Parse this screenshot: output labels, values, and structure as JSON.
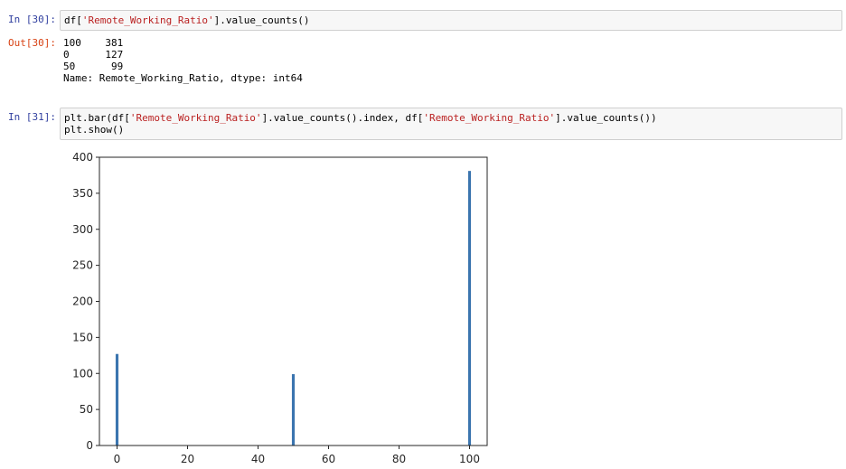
{
  "cells": [
    {
      "in_prompt": "In [30]:",
      "code": [
        [
          {
            "t": "df[",
            "c": ""
          },
          {
            "t": "'Remote_Working_Ratio'",
            "c": "str"
          },
          {
            "t": "].value_counts()",
            "c": ""
          }
        ]
      ],
      "out_prompt": "Out[30]:",
      "output_lines": [
        "100    381",
        "0      127",
        "50      99",
        "Name: Remote_Working_Ratio, dtype: int64"
      ]
    },
    {
      "in_prompt": "In [31]:",
      "code": [
        [
          {
            "t": "plt.bar(df[",
            "c": ""
          },
          {
            "t": "'Remote_Working_Ratio'",
            "c": "str"
          },
          {
            "t": "].value_counts().index, df[",
            "c": ""
          },
          {
            "t": "'Remote_Working_Ratio'",
            "c": "str"
          },
          {
            "t": "].value_counts())",
            "c": ""
          }
        ],
        [
          {
            "t": "plt.show()",
            "c": ""
          }
        ]
      ]
    }
  ],
  "chart_data": {
    "type": "bar",
    "x": [
      100,
      0,
      50
    ],
    "values": [
      381,
      127,
      99
    ],
    "xlim": [
      -5,
      105
    ],
    "ylim": [
      0,
      400
    ],
    "xticks": [
      0,
      20,
      40,
      60,
      80,
      100
    ],
    "yticks": [
      0,
      50,
      100,
      150,
      200,
      250,
      300,
      350,
      400
    ],
    "bar_width": 0.8,
    "bar_color": "#3b75af",
    "grid": false,
    "title": "",
    "xlabel": "",
    "ylabel": ""
  }
}
